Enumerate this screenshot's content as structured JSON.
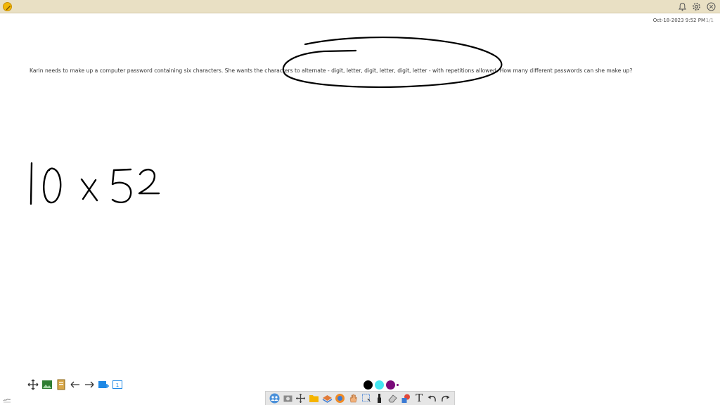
{
  "app": {
    "logo_icon": "pencil-app-logo-icon",
    "titlebar_color": "#e9e0c4",
    "titlebar_buttons": [
      "bell-icon",
      "gear-icon",
      "close-icon"
    ]
  },
  "page": {
    "timestamp": "Oct-18-2023 9:52 PM",
    "page_indicator": "1/1"
  },
  "question": {
    "text": "Karin needs to make up a computer password containing six characters. She wants the characters to alternate - digit, letter, digit, letter, digit, letter - with repetitions allowed. How many different passwords can she make up?"
  },
  "handwriting": {
    "expression": "10 x 52",
    "ink_color": "#000000",
    "annotation": "ellipse circling \"to alternate - digit, letter, digit, letter, digit, letter\""
  },
  "left_toolbar": {
    "tools": [
      "move-icon",
      "image-insert-icon",
      "document-icon",
      "arrow-left-icon",
      "arrow-right-icon",
      "add-page-icon",
      "page-number-icon"
    ],
    "page_number_label": "1"
  },
  "colors": {
    "swatches": [
      "#000000",
      "#44e6f0",
      "#7a0a7a"
    ],
    "selected": "#7a0a7a"
  },
  "bottom_toolbar": {
    "tools": [
      "people-icon",
      "screenshot-icon",
      "move-icon",
      "folder-icon",
      "layers-icon",
      "browser-icon",
      "hand-icon",
      "select-icon",
      "pen-icon",
      "eraser-icon",
      "shapes-icon",
      "text-icon",
      "undo-icon",
      "redo-icon"
    ],
    "text_tool_label": "T"
  }
}
